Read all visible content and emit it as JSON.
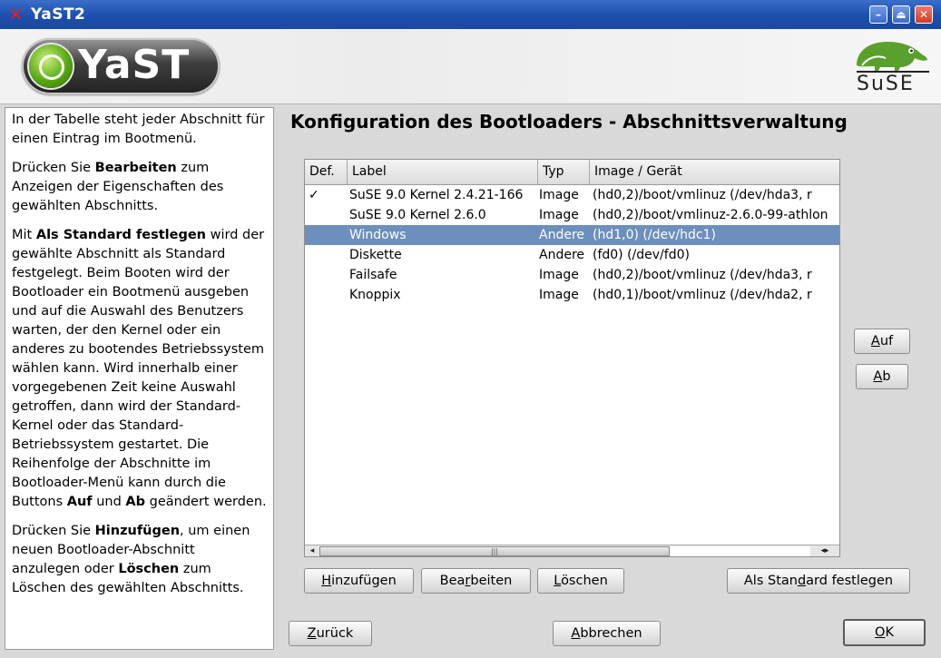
{
  "window": {
    "title": "YaST2",
    "app_icon_glyph": "✕",
    "minimize_glyph": "–",
    "maximize_glyph": "⏏",
    "close_glyph": "✕"
  },
  "banner": {
    "yast_text": "YaST",
    "suse_text": "SuSE"
  },
  "help": {
    "p1": "In der Tabelle steht jeder Abschnitt für einen Eintrag im Bootmenü.",
    "p2_a": "Drücken Sie ",
    "p2_b": "Bearbeiten",
    "p2_c": " zum Anzeigen der Eigenschaften des gewählten Abschnitts.",
    "p3_a": "Mit ",
    "p3_b": "Als Standard festlegen",
    "p3_c": " wird der gewählte Abschnitt als Standard festgelegt. Beim Booten wird der Bootloader ein Bootmenü ausgeben und auf die Auswahl des Benutzers warten, der den Kernel oder ein anderes zu bootendes Betriebssystem wählen kann. Wird innerhalb einer vorgegebenen Zeit keine Auswahl getroffen, dann wird der Standard-Kernel oder das Standard-Betriebssystem gestartet. Die Reihenfolge der Abschnitte im Bootloader-Menü kann durch die Buttons ",
    "p3_d": "Auf",
    "p3_e": " und ",
    "p3_f": "Ab",
    "p3_g": " geändert werden.",
    "p4_a": "Drücken Sie ",
    "p4_b": "Hinzufügen",
    "p4_c": ", um einen neuen Bootloader-Abschnitt anzulegen oder ",
    "p4_d": "Löschen",
    "p4_e": " zum Löschen des gewählten Abschnitts."
  },
  "heading": "Konfiguration des Bootloaders - Abschnittsverwaltung",
  "table": {
    "columns": [
      "Def.",
      "Label",
      "Typ",
      "Image / Gerät"
    ],
    "rows": [
      {
        "def": "✓",
        "label": "SuSE 9.0 Kernel 2.4.21-166",
        "typ": "Image",
        "image": "(hd0,2)/boot/vmlinuz   (/dev/hda3, r"
      },
      {
        "def": "",
        "label": "SuSE 9.0 Kernel 2.6.0",
        "typ": "Image",
        "image": "(hd0,2)/boot/vmlinuz-2.6.0-99-athlon"
      },
      {
        "def": "",
        "label": "Windows",
        "typ": "Andere",
        "image": "(hd1,0)   (/dev/hdc1)"
      },
      {
        "def": "",
        "label": "Diskette",
        "typ": "Andere",
        "image": "(fd0)   (/dev/fd0)"
      },
      {
        "def": "",
        "label": "Failsafe",
        "typ": "Image",
        "image": "(hd0,2)/boot/vmlinuz   (/dev/hda3, r"
      },
      {
        "def": "",
        "label": "Knoppix",
        "typ": "Image",
        "image": "(hd0,1)/boot/vmlinuz   (/dev/hda2, r"
      }
    ],
    "selected_row": 2,
    "scroll_left_glyph": "◂",
    "scroll_right_glyph": "◂▸",
    "thumb_grip": "|||"
  },
  "buttons": {
    "up": {
      "pre": "",
      "key": "A",
      "post": "uf"
    },
    "down": {
      "pre": "",
      "key": "A",
      "post": "b"
    },
    "add": {
      "pre": "",
      "key": "H",
      "post": "inzufügen"
    },
    "edit": {
      "pre": "Bea",
      "key": "r",
      "post": "beiten"
    },
    "delete": {
      "pre": "",
      "key": "L",
      "post": "öschen"
    },
    "set_default": {
      "pre": "Als Stan",
      "key": "d",
      "post": "ard festlegen"
    },
    "back": {
      "pre": "",
      "key": "Z",
      "post": "urück"
    },
    "abort": {
      "pre": "",
      "key": "A",
      "post": "bbrechen"
    },
    "ok": {
      "pre": "",
      "key": "O",
      "post": "K"
    }
  },
  "colors": {
    "titlebar": "#1c4fae",
    "selection": "#6d8fbd",
    "yast_green": "#58a812",
    "suse_green": "#5aa02c"
  }
}
